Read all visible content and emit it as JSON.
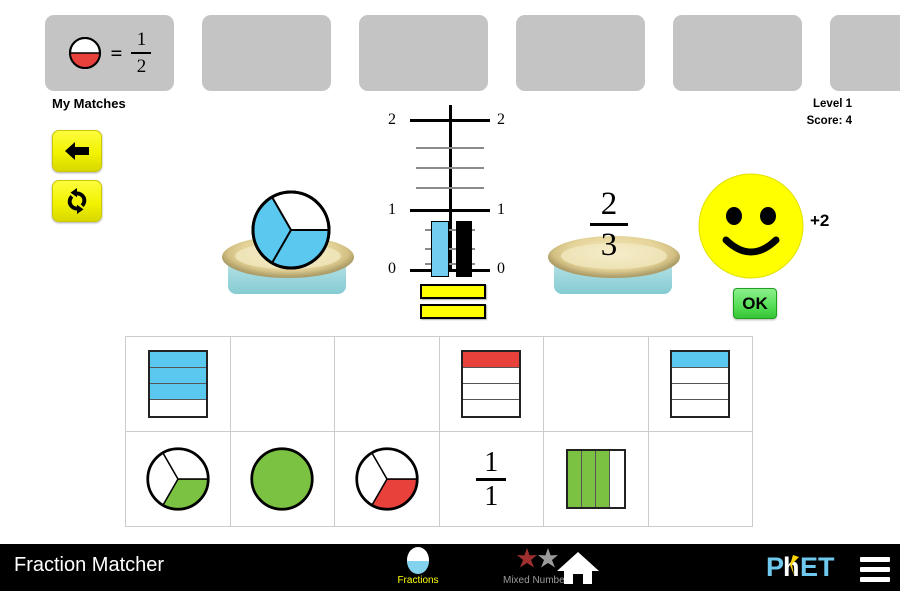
{
  "app": {
    "title": "Fraction Matcher",
    "level_label": "Level 1",
    "score_label": "Score: 4"
  },
  "matches": {
    "header_label": "My Matches",
    "boxes": [
      {
        "filled": true,
        "shape": "circle-half-red",
        "equals": "=",
        "numerator": "1",
        "denominator": "2"
      },
      {
        "filled": false
      },
      {
        "filled": false
      },
      {
        "filled": false
      },
      {
        "filled": false
      },
      {
        "filled": false
      }
    ]
  },
  "side_buttons": [
    {
      "icon": "back-arrow-icon",
      "name": "back-button"
    },
    {
      "icon": "refresh-icon",
      "name": "refresh-button"
    }
  ],
  "scale": {
    "tick_labels_left": [
      "2",
      "1",
      "0"
    ],
    "tick_labels_right": [
      "2",
      "1",
      "0"
    ],
    "left_bar_value": 0.67,
    "left_bar_color": "#73cdf0",
    "right_bar_value": 0.7,
    "right_bar_color": "#000000",
    "axis_max": 2,
    "yellow_bar_count": 2
  },
  "left_platform": {
    "shape": "pie-two-thirds-blue",
    "filled_parts": 2,
    "total_parts": 3,
    "color": "#73cdf0"
  },
  "right_platform": {
    "shape": "fraction",
    "numerator": "2",
    "denominator": "3"
  },
  "feedback": {
    "face": "smiley-face",
    "points": "+2",
    "ok_label": "OK"
  },
  "card_grid": {
    "columns": 6,
    "rows": 2,
    "cells": [
      {
        "type": "rect",
        "segments": 4,
        "filled": 3,
        "color": "#5bc8f0",
        "orientation": "horizontal"
      },
      {
        "type": "empty"
      },
      {
        "type": "empty"
      },
      {
        "type": "rect",
        "segments": 4,
        "filled": 1,
        "color": "#e8403a",
        "orientation": "horizontal"
      },
      {
        "type": "empty"
      },
      {
        "type": "rect",
        "segments": 4,
        "filled": 1,
        "color": "#5bc8f0",
        "orientation": "horizontal"
      },
      {
        "type": "pie",
        "segments": 3,
        "filled": 1,
        "color": "#7cc242"
      },
      {
        "type": "pie",
        "segments": 1,
        "filled": 1,
        "color": "#7cc242"
      },
      {
        "type": "pie",
        "segments": 3,
        "filled": 1,
        "color": "#e8403a"
      },
      {
        "type": "fraction",
        "numerator": "1",
        "denominator": "1"
      },
      {
        "type": "rect",
        "segments": 4,
        "filled": 3,
        "color": "#7cc242",
        "orientation": "vertical"
      },
      {
        "type": "empty"
      }
    ]
  },
  "navbar": {
    "title": "Fraction Matcher",
    "tabs": [
      {
        "label": "Fractions",
        "active": true,
        "icon": "fraction-circle-icon"
      },
      {
        "label": "Mixed Numbers",
        "active": false,
        "icon": "two-stars-icon"
      }
    ],
    "home_icon": "home-icon",
    "logo": "phet-logo",
    "menu_icon": "hamburger-menu-icon"
  },
  "colors": {
    "blue": "#5bc8f0",
    "green": "#7cc242",
    "red": "#e8403a",
    "yellow": "#ffff00",
    "box_gray": "#c4c4c4"
  }
}
